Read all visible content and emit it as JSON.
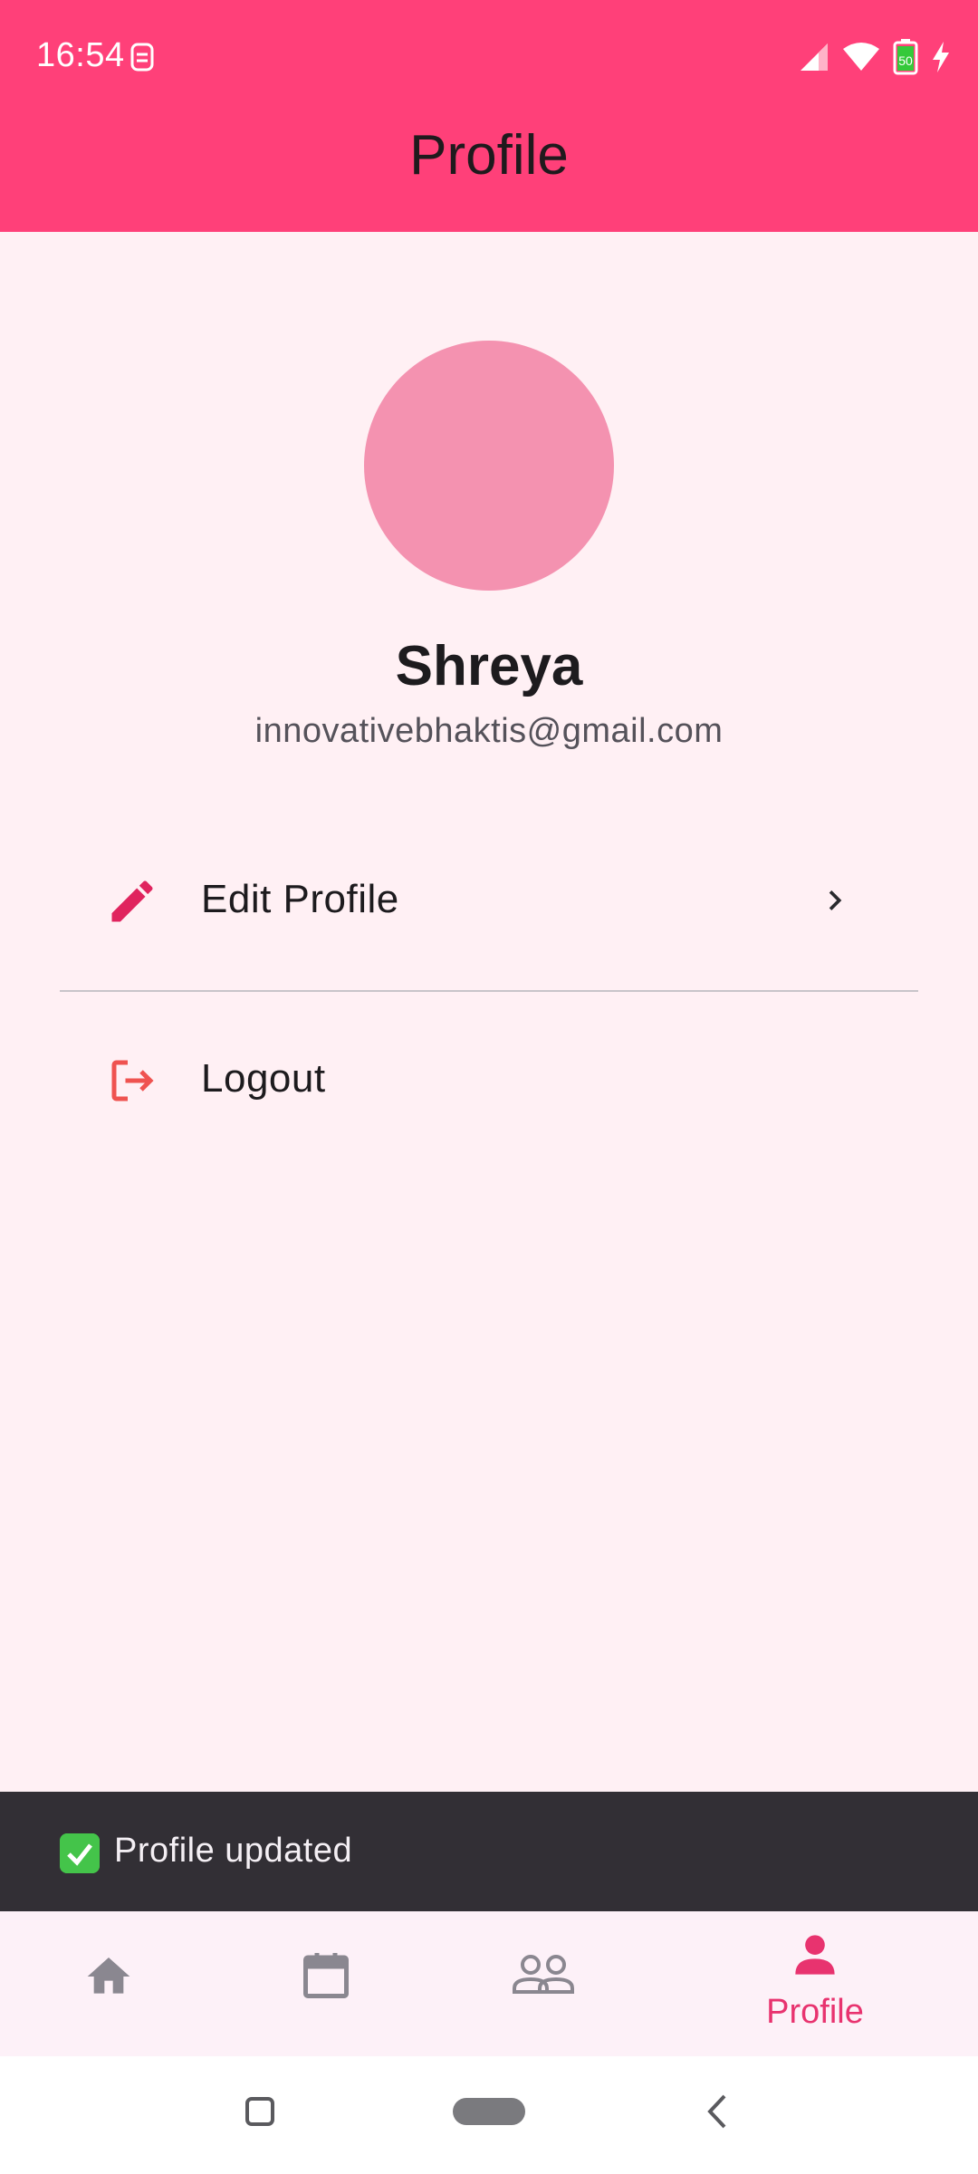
{
  "status_bar": {
    "time": "16:54",
    "battery_level": "50"
  },
  "app_bar": {
    "title": "Profile"
  },
  "profile": {
    "name": "Shreya",
    "email": "innovativebhaktis@gmail.com",
    "avatar_color": "#f492b0"
  },
  "menu": {
    "edit_profile_label": "Edit Profile",
    "logout_label": "Logout"
  },
  "snackbar": {
    "message": "Profile updated"
  },
  "bottom_nav": {
    "items": [
      {
        "icon": "home-icon",
        "label": ""
      },
      {
        "icon": "calendar-icon",
        "label": ""
      },
      {
        "icon": "groups-icon",
        "label": ""
      },
      {
        "icon": "person-icon",
        "label": "Profile",
        "active": true
      }
    ]
  },
  "colors": {
    "accent": "#ff4079",
    "background": "#fff0f4",
    "snackbar": "#322f35",
    "active_nav": "#e8336f"
  }
}
